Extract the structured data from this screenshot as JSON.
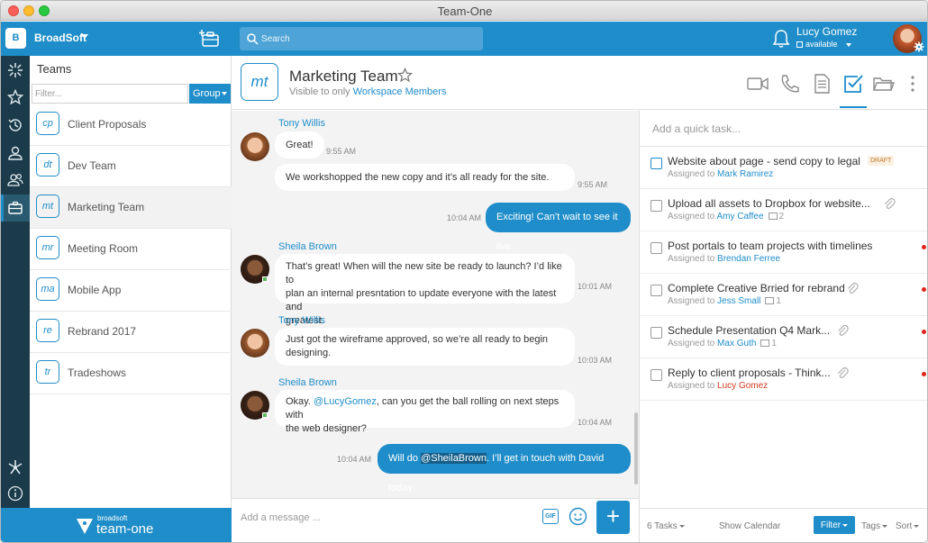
{
  "window": {
    "title": "Team-One"
  },
  "header": {
    "org_initial": "B",
    "org_name": "BroadSoft",
    "search_placeholder": "Search",
    "user_name": "Lucy Gomez",
    "user_status": "available"
  },
  "teams_panel": {
    "title": "Teams",
    "filter_placeholder": "Filter...",
    "group_label": "Group",
    "items": [
      {
        "initials": "cp",
        "label": "Client Proposals"
      },
      {
        "initials": "dt",
        "label": "Dev Team"
      },
      {
        "initials": "mt",
        "label": "Marketing Team"
      },
      {
        "initials": "mr",
        "label": "Meeting Room"
      },
      {
        "initials": "ma",
        "label": "Mobile App"
      },
      {
        "initials": "re",
        "label": "Rebrand 2017"
      },
      {
        "initials": "tr",
        "label": "Tradeshows"
      }
    ]
  },
  "brand": {
    "top": "broadsoft",
    "name": "team-one"
  },
  "chat": {
    "initials": "mt",
    "title": "Marketing Team",
    "visibility_prefix": "Visible to only ",
    "visibility_link": "Workspace Members",
    "composer_placeholder": "Add a message ...",
    "gif_label": "GIF",
    "plus_label": "+",
    "messages": [
      {
        "name": "Tony Willis",
        "text": "Great!",
        "time": "9:55 AM"
      },
      {
        "text": "We workshopped the new copy and it’s all ready for the site.",
        "time": "9:55 AM"
      },
      {
        "text": "Exciting! Can’t wait to see it live.",
        "time": "10:04 AM"
      },
      {
        "name": "Sheila Brown",
        "line1": "That’s great! When will the new site be ready to launch? I’d like to",
        "line2": "plan an internal presntation to update everyone with the latest and",
        "line3": "greatest.",
        "time": "10:01 AM"
      },
      {
        "name": "Tony Willis",
        "line1": "Just got the wireframe approved, so we’re all ready to begin",
        "line2": "designing.",
        "time": "10:03 AM"
      },
      {
        "name": "Sheila Brown",
        "pre": "Okay. ",
        "mention": "@LucyGomez",
        "post": ", can you get the ball rolling on next steps with",
        "line2": "the web designer?",
        "time": "10:04 AM"
      },
      {
        "pre": "Will do ",
        "mention": "@SheilaBrown",
        "post": ". I’ll get in touch with David today.",
        "time": "10:04 AM"
      }
    ]
  },
  "tasks": {
    "quick_placeholder": "Add a quick task...",
    "assigned_prefix": "Assigned to ",
    "draft_label": "DRAFT",
    "items": [
      {
        "title": "Website about page - send copy to legal",
        "assignee": "Mark Ramirez"
      },
      {
        "title": "Upload all assets to Dropbox for website...",
        "assignee": "Amy Caffee",
        "comments": "2"
      },
      {
        "title": "Post portals to team projects with timelines",
        "assignee": "Brendan Ferree"
      },
      {
        "title": "Complete Creative Brried for rebrand",
        "assignee": "Jess Small",
        "comments": "1"
      },
      {
        "title": "Schedule Presentation Q4 Mark...",
        "assignee": "Max Guth",
        "comments": "1"
      },
      {
        "title": "Reply to client proposals - Think...",
        "assignee": "Lucy Gomez"
      }
    ],
    "footer": {
      "count": "6 Tasks",
      "calendar": "Show Calendar",
      "filter": "Filter",
      "tags": "Tags",
      "sort": "Sort"
    }
  },
  "colors": {
    "accent": "#1f8dc9",
    "rail": "#1b3b4b",
    "alert": "#e0241a"
  }
}
